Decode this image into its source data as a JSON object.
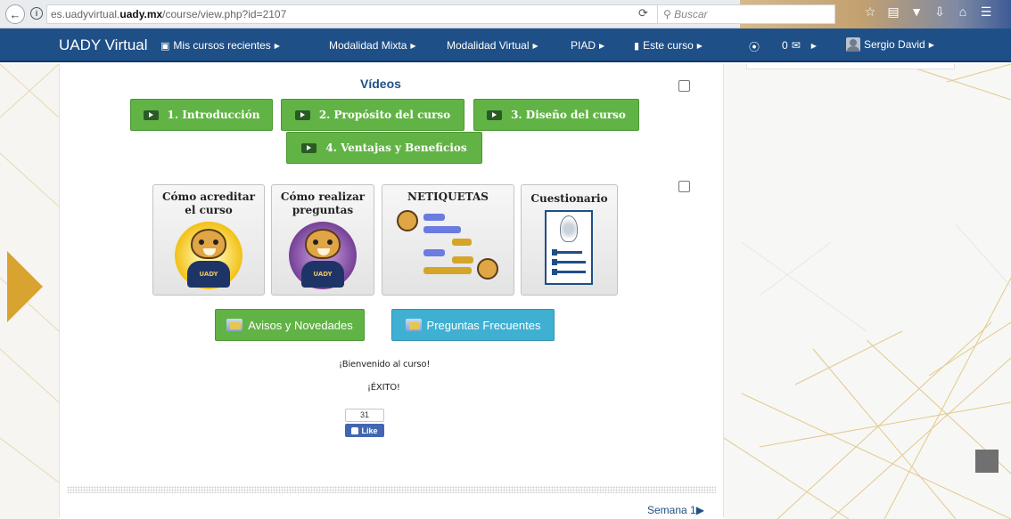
{
  "browser": {
    "url_prefix": "es.uadyvirtual.",
    "url_domain": "uady.mx",
    "url_path": "/course/view.php?id=2107",
    "search_placeholder": "Buscar"
  },
  "navbar": {
    "brand": "UADY Virtual",
    "items": [
      {
        "label": "Mis cursos recientes"
      },
      {
        "label": "Modalidad Mixta"
      },
      {
        "label": "Modalidad Virtual"
      },
      {
        "label": "PIAD"
      },
      {
        "label": "Este curso"
      }
    ],
    "messages_count": "0",
    "user_name": "Sergio David"
  },
  "section": {
    "title": "Vídeos",
    "video_buttons": [
      {
        "label": "1. Introducción"
      },
      {
        "label": "2. Propósito del curso"
      },
      {
        "label": "3. Diseño del curso"
      },
      {
        "label": "4. Ventajas y Beneficios"
      }
    ],
    "cards": [
      {
        "title_line1": "Cómo acreditar",
        "title_line2": "el curso",
        "mascot_text": "UADY"
      },
      {
        "title_line1": "Cómo realizar",
        "title_line2": "preguntas",
        "mascot_text": "UADY"
      },
      {
        "title_line1": "NETIQUETAS",
        "title_line2": ""
      },
      {
        "title_line1": "Cuestionario",
        "title_line2": ""
      }
    ],
    "actions": [
      {
        "label": "Avisos y Novedades"
      },
      {
        "label": "Preguntas Frecuentes"
      }
    ],
    "welcome": "¡Bienvenido al curso!",
    "success": "¡ÉXITO!",
    "like": {
      "count": "31",
      "label": "Like"
    },
    "next_week": "Semana 1"
  },
  "colors": {
    "navbar": "#1f4f87",
    "green_button": "#62b346",
    "blue_button": "#3fb0d2",
    "accent_gold": "#d9a330"
  }
}
